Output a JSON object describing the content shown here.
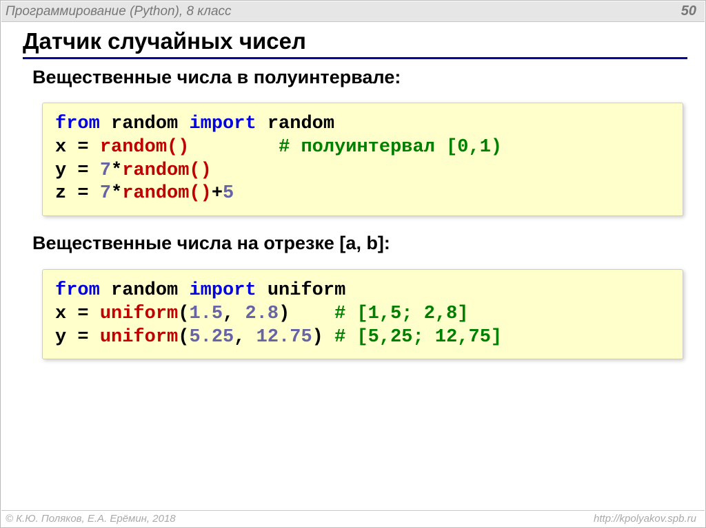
{
  "header": {
    "title": "Программирование (Python), 8 класс",
    "page": "50"
  },
  "title": "Датчик случайных чисел",
  "section1_title": "Вещественные числа в полуинтервале:",
  "section2_title": "Вещественные числа на отрезке [a, b]:",
  "code1": {
    "l1_kw1": "from",
    "l1_id1": "random",
    "l1_kw2": "import",
    "l1_id2": "random",
    "l2_a": "x =",
    "l2_fn": "random()",
    "l2_pad": "        ",
    "l2_cm": "# полуинтервал [0,1)",
    "l3_a": "y = ",
    "l3_n": "7",
    "l3_b": "*",
    "l3_fn": "random()",
    "l4_a": "z = ",
    "l4_n": "7",
    "l4_b": "*",
    "l4_fn": "random()",
    "l4_c": "+",
    "l4_n2": "5"
  },
  "code2": {
    "l1_kw1": "from",
    "l1_id1": "random",
    "l1_kw2": "import",
    "l1_id2": "uniform",
    "l2_a": "x =",
    "l2_fn": "uniform",
    "l2_p1": "(",
    "l2_n1": "1.5",
    "l2_c": ", ",
    "l2_n2": "2.8",
    "l2_p2": ")",
    "l2_pad": "    ",
    "l2_cm": "# [1,5; 2,8]",
    "l3_a": "y =",
    "l3_fn": "uniform",
    "l3_p1": "(",
    "l3_n1": "5.25",
    "l3_c": ", ",
    "l3_n2": "12.75",
    "l3_p2": ")",
    "l3_sp": " ",
    "l3_cm": "# [5,25; 12,75]"
  },
  "footer": {
    "copyright": "© К.Ю. Поляков, Е.А. Ерёмин, 2018",
    "url": "http://kpolyakov.spb.ru"
  }
}
